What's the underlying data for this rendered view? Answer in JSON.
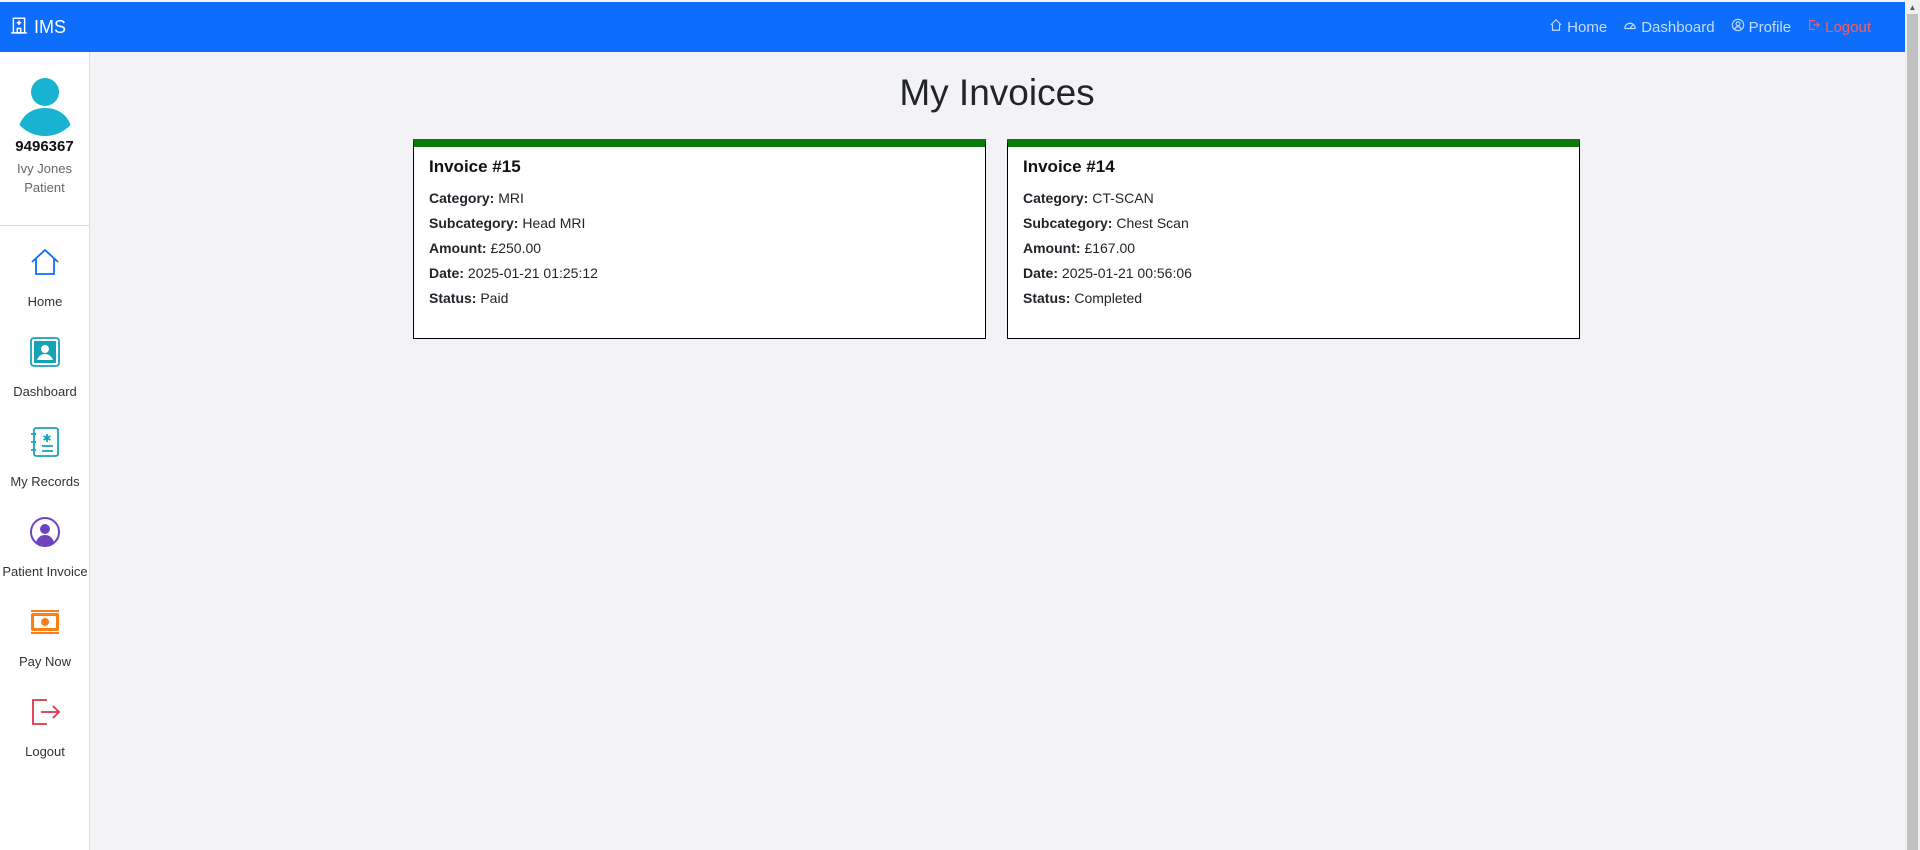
{
  "navbar": {
    "brand": "IMS",
    "brand_icon": "hospital-icon",
    "links": [
      {
        "label": "Home",
        "icon": "home-icon"
      },
      {
        "label": "Dashboard",
        "icon": "speedometer-icon"
      },
      {
        "label": "Profile",
        "icon": "person-circle-icon"
      },
      {
        "label": "Logout",
        "icon": "logout-icon"
      }
    ]
  },
  "profile": {
    "id": "9496367",
    "name": "Ivy Jones",
    "role": "Patient"
  },
  "sidebar": {
    "items": [
      {
        "label": "Home",
        "icon": "home-icon",
        "color": "#0d6efd"
      },
      {
        "label": "Dashboard",
        "icon": "user-card-icon",
        "color": "#17a2b8"
      },
      {
        "label": "My Records",
        "icon": "records-icon",
        "color": "#17a2b8"
      },
      {
        "label": "Patient Invoice",
        "icon": "person-circle-icon",
        "color": "#6f42c1"
      },
      {
        "label": "Pay Now",
        "icon": "cash-icon",
        "color": "#fd7e14"
      },
      {
        "label": "Logout",
        "icon": "logout-icon",
        "color": "#dc3545"
      }
    ]
  },
  "page": {
    "title": "My Invoices"
  },
  "labels": {
    "category": "Category:",
    "subcategory": "Subcategory:",
    "amount": "Amount:",
    "date": "Date:",
    "status": "Status:"
  },
  "invoices": [
    {
      "title": "Invoice #15",
      "category": "MRI",
      "subcategory": "Head MRI",
      "amount": "£250.00",
      "date": "2025-01-21 01:25:12",
      "status": "Paid"
    },
    {
      "title": "Invoice #14",
      "category": "CT-SCAN",
      "subcategory": "Chest Scan",
      "amount": "£167.00",
      "date": "2025-01-21 00:56:06",
      "status": "Completed"
    }
  ],
  "colors": {
    "navbar": "#0d6efd",
    "card_accent": "#0a7a0a",
    "logout": "#ff5a5a"
  }
}
